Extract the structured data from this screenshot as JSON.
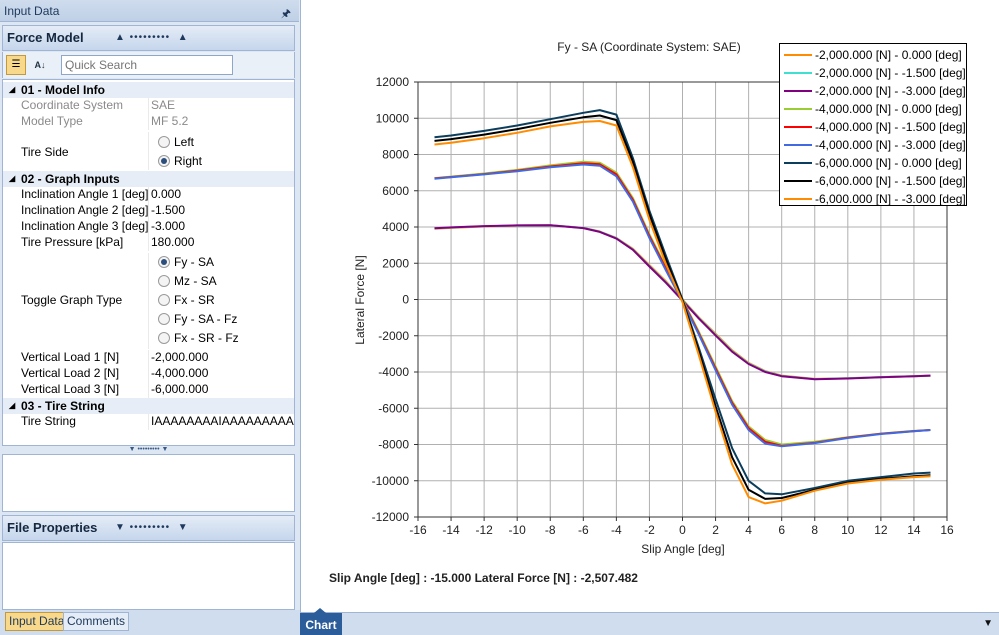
{
  "left_panel": {
    "title": "Input Data",
    "force_model_header": "Force Model",
    "search_placeholder": "Quick Search",
    "categories": {
      "c1": "01 - Model Info",
      "c2": "02 - Graph Inputs",
      "c3": "03 - Tire String"
    },
    "rows": {
      "coord_system": {
        "label": "Coordinate System",
        "value": "SAE"
      },
      "model_type": {
        "label": "Model Type",
        "value": "MF 5.2"
      },
      "tire_side": {
        "label": "Tire Side",
        "options": [
          "Left",
          "Right"
        ],
        "selected": "Right"
      },
      "incl1": {
        "label": "Inclination Angle 1 [deg]",
        "value": "0.000"
      },
      "incl2": {
        "label": "Inclination Angle 2 [deg]",
        "value": "-1.500"
      },
      "incl3": {
        "label": "Inclination Angle 3 [deg]",
        "value": "-3.000"
      },
      "pressure": {
        "label": "Tire Pressure [kPa]",
        "value": "180.000"
      },
      "toggle": {
        "label": "Toggle Graph Type",
        "options": [
          "Fy - SA",
          "Mz - SA",
          "Fx - SR",
          "Fy - SA - Fz",
          "Fx - SR - Fz"
        ],
        "selected": "Fy - SA"
      },
      "load1": {
        "label": "Vertical Load 1 [N]",
        "value": "-2,000.000"
      },
      "load2": {
        "label": "Vertical Load 2 [N]",
        "value": "-4,000.000"
      },
      "load3": {
        "label": "Vertical Load 3 [N]",
        "value": "-6,000.000"
      },
      "tire_string": {
        "label": "Tire String",
        "value": "IAAAAAAAAIAAAAAAAAAI"
      }
    },
    "file_properties_header": "File Properties",
    "tabs": [
      "Input Data",
      "Comments"
    ]
  },
  "right_panel": {
    "readout": "Slip Angle [deg] : -15.000 Lateral Force [N] : -2,507.482",
    "bottom_tab": "Chart"
  },
  "chart_data": {
    "type": "line",
    "title": "Fy - SA (Coordinate System: SAE)",
    "xlabel": "Slip Angle [deg]",
    "ylabel": "Lateral Force [N]",
    "xlim": [
      -16,
      16
    ],
    "ylim": [
      -12000,
      12000
    ],
    "xticks": [
      "-16",
      "-14",
      "-12",
      "-10",
      "-8",
      "-6",
      "-4",
      "-2",
      "0",
      "2",
      "4",
      "6",
      "8",
      "10",
      "12",
      "14",
      "16"
    ],
    "yticks": [
      "12000",
      "10000",
      "8000",
      "6000",
      "4000",
      "2000",
      "0",
      "-2000",
      "-4000",
      "-6000",
      "-8000",
      "-10000",
      "-12000"
    ],
    "grid": true,
    "legend_position": "top-right",
    "x": [
      -15,
      -14,
      -12,
      -10,
      -8,
      -6,
      -5,
      -4,
      -3,
      -2,
      -1,
      0,
      1,
      2,
      3,
      4,
      5,
      6,
      8,
      10,
      12,
      14,
      15
    ],
    "series": [
      {
        "name": "-2,000.000 [N] - 0.000 [deg]",
        "color": "#ff8c00",
        "values": [
          3900,
          3950,
          4030,
          4080,
          4100,
          3950,
          3750,
          3400,
          2800,
          1900,
          1000,
          0,
          -1000,
          -1900,
          -2800,
          -3500,
          -3950,
          -4200,
          -4380,
          -4350,
          -4280,
          -4230,
          -4200
        ]
      },
      {
        "name": "-2,000.000 [N] - -1.500 [deg]",
        "color": "#40e0d0",
        "values": [
          3920,
          3970,
          4040,
          4090,
          4100,
          3950,
          3740,
          3380,
          2760,
          1850,
          950,
          -30,
          -1030,
          -1950,
          -2850,
          -3530,
          -3970,
          -4220,
          -4390,
          -4350,
          -4280,
          -4230,
          -4200
        ]
      },
      {
        "name": "-2,000.000 [N] - -3.000 [deg]",
        "color": "#800080",
        "values": [
          3930,
          3980,
          4050,
          4090,
          4100,
          3940,
          3730,
          3360,
          2740,
          1820,
          920,
          -60,
          -1060,
          -1980,
          -2880,
          -3560,
          -4000,
          -4230,
          -4400,
          -4360,
          -4290,
          -4230,
          -4200
        ]
      },
      {
        "name": "-4,000.000 [N] - 0.000 [deg]",
        "color": "#9acd32",
        "values": [
          6700,
          6780,
          6950,
          7150,
          7400,
          7600,
          7550,
          7000,
          5600,
          3600,
          1800,
          0,
          -1800,
          -3700,
          -5600,
          -7000,
          -7750,
          -8000,
          -7850,
          -7600,
          -7400,
          -7250,
          -7200
        ]
      },
      {
        "name": "-4,000.000 [N] - -1.500 [deg]",
        "color": "#ff0000",
        "values": [
          6680,
          6760,
          6920,
          7110,
          7340,
          7520,
          7460,
          6900,
          5500,
          3500,
          1700,
          -60,
          -1880,
          -3800,
          -5700,
          -7100,
          -7850,
          -8080,
          -7900,
          -7620,
          -7410,
          -7260,
          -7200
        ]
      },
      {
        "name": "-4,000.000 [N] - -3.000 [deg]",
        "color": "#4169e1",
        "values": [
          6660,
          6740,
          6900,
          7080,
          7300,
          7450,
          7380,
          6800,
          5400,
          3400,
          1600,
          -120,
          -1950,
          -3900,
          -5800,
          -7200,
          -7950,
          -8100,
          -7920,
          -7640,
          -7420,
          -7270,
          -7200
        ]
      },
      {
        "name": "-6,000.000 [N] - 0.000 [deg]",
        "color": "#0b3d5c",
        "values": [
          8950,
          9050,
          9300,
          9600,
          9950,
          10300,
          10450,
          10200,
          7800,
          4900,
          2400,
          0,
          -2700,
          -5500,
          -8200,
          -10000,
          -10700,
          -10750,
          -10400,
          -10000,
          -9800,
          -9600,
          -9550
        ]
      },
      {
        "name": "-6,000.000 [N] - -1.500 [deg]",
        "color": "#000000",
        "values": [
          8750,
          8850,
          9100,
          9400,
          9750,
          10050,
          10150,
          9900,
          7600,
          4700,
          2200,
          -80,
          -2900,
          -5900,
          -8700,
          -10500,
          -11000,
          -10950,
          -10500,
          -10100,
          -9900,
          -9750,
          -9700
        ]
      },
      {
        "name": "-6,000.000 [N] - -3.000 [deg]",
        "color": "#ff8c00",
        "values": [
          8550,
          8650,
          8900,
          9200,
          9550,
          9800,
          9850,
          9600,
          7300,
          4400,
          1950,
          -150,
          -3100,
          -6200,
          -9100,
          -10900,
          -11250,
          -11100,
          -10550,
          -10150,
          -9950,
          -9800,
          -9750
        ]
      }
    ]
  }
}
